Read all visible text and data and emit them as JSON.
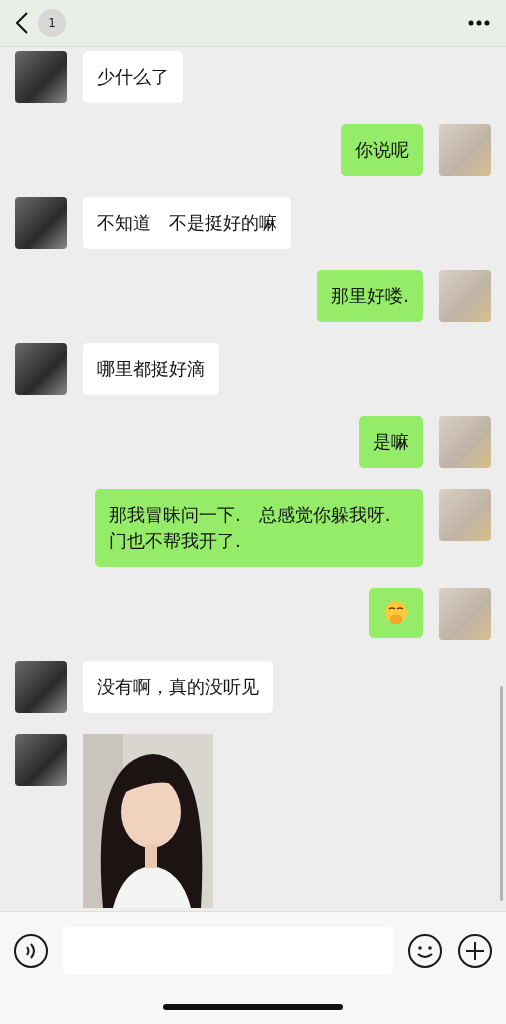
{
  "header": {
    "unread_count": "1"
  },
  "messages": [
    {
      "outgoing": false,
      "kind": "text",
      "text": "少什么了"
    },
    {
      "outgoing": true,
      "kind": "text",
      "text": "你说呢"
    },
    {
      "outgoing": false,
      "kind": "text",
      "text": "不知道　不是挺好的嘛"
    },
    {
      "outgoing": true,
      "kind": "text",
      "text": "那里好喽."
    },
    {
      "outgoing": false,
      "kind": "text",
      "text": "哪里都挺好滴"
    },
    {
      "outgoing": true,
      "kind": "text",
      "text": "是嘛"
    },
    {
      "outgoing": true,
      "kind": "text",
      "text": "那我冒昧问一下.　总感觉你躲我呀.　门也不帮我开了."
    },
    {
      "outgoing": true,
      "kind": "emoji"
    },
    {
      "outgoing": false,
      "kind": "text",
      "text": "没有啊，真的没听见"
    },
    {
      "outgoing": false,
      "kind": "sticker"
    }
  ]
}
